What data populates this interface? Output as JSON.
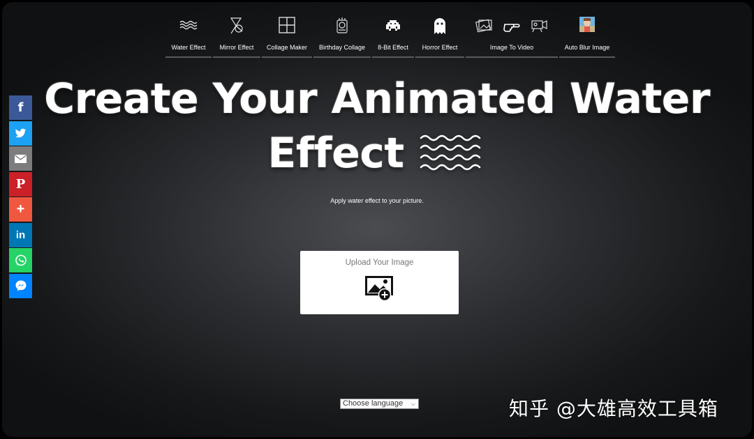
{
  "nav": {
    "items": [
      {
        "label": "Water Effect",
        "icon": "water-waves-icon"
      },
      {
        "label": "Mirror Effect",
        "icon": "mirror-icon"
      },
      {
        "label": "Collage Maker",
        "icon": "collage-grid-icon"
      },
      {
        "label": "Birthday Collage",
        "icon": "birthday-cake-icon"
      },
      {
        "label": "8-Bit Effect",
        "icon": "space-invader-icon"
      },
      {
        "label": "Horror Effect",
        "icon": "ghost-icon"
      },
      {
        "label": "Image To Video",
        "icon": "image-to-video-icons"
      },
      {
        "label": "Auto Blur Image",
        "icon": "blur-thumbnail-icon"
      }
    ]
  },
  "social": [
    {
      "name": "facebook",
      "glyph": "f",
      "color": "#3b5998"
    },
    {
      "name": "twitter",
      "glyph": "t",
      "color": "#1da1f2"
    },
    {
      "name": "email",
      "glyph": "✉",
      "color": "#7d7d7d"
    },
    {
      "name": "pinterest",
      "glyph": "P",
      "color": "#cb2027"
    },
    {
      "name": "more",
      "glyph": "+",
      "color": "#f0573f"
    },
    {
      "name": "linkedin",
      "glyph": "in",
      "color": "#0077b5"
    },
    {
      "name": "whatsapp",
      "glyph": "w",
      "color": "#25d366"
    },
    {
      "name": "messenger",
      "glyph": "m",
      "color": "#0084ff"
    }
  ],
  "headline": {
    "line1": "Create Your Animated Water",
    "line2": "Effect"
  },
  "subtitle": "Apply water effect to your picture.",
  "upload": {
    "label": "Upload Your Image"
  },
  "language": {
    "selected": "Choose language"
  },
  "watermark": "知乎 @大雄高效工具箱",
  "colors": {
    "upload_bg": "#ffffff",
    "text": "#ffffff",
    "nav_underline": "#5a5b5f"
  }
}
